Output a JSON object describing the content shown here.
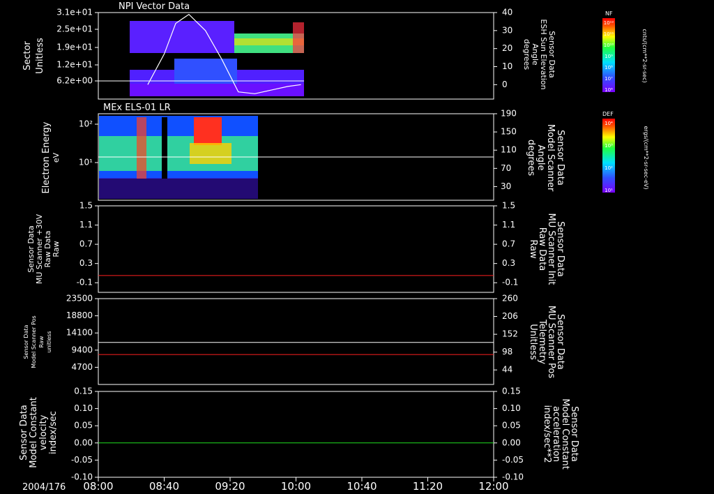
{
  "chart_data": [
    {
      "type": "heatmap",
      "title": "NPI Vector Data",
      "left_axis": {
        "label": [
          "Sector",
          "Unitless"
        ],
        "ticks": [
          "3.1e+01",
          "2.5e+01",
          "1.9e+01",
          "1.2e+01",
          "6.2e+00"
        ]
      },
      "right_axis": {
        "label": [
          "Sensor Data",
          "ESH Sun Elevation",
          "Angle",
          "degrees"
        ],
        "range": [
          -8,
          40
        ],
        "ticks": [
          "40",
          "30",
          "20",
          "10",
          "0"
        ]
      },
      "colorbar": {
        "title": "NF",
        "unit": "cnts/(cm**2-sr-sec)",
        "ticks": [
          "10¹²",
          "10¹¹",
          "10¹⁰",
          "10⁹",
          "10⁸",
          "10⁷",
          "10⁶"
        ]
      },
      "line_series": {
        "color": "#ffffff",
        "x": [
          "08:30",
          "08:40",
          "08:47",
          "08:55",
          "09:05",
          "09:15",
          "09:25",
          "09:35",
          "09:45",
          "09:55",
          "10:03"
        ],
        "y": [
          0,
          17,
          34,
          39,
          30,
          14,
          -4,
          -5,
          -3,
          -1,
          0
        ]
      }
    },
    {
      "type": "heatmap",
      "title": "MEx ELS-01 LR",
      "left_axis": {
        "label": [
          "Electron Energy",
          "eV"
        ],
        "scale": "log",
        "ticks": [
          "10²",
          "10¹"
        ]
      },
      "right_axis": {
        "label": [
          "Sensor Data",
          "Model Scanner",
          "Angle",
          "degrees"
        ],
        "range": [
          0,
          190
        ],
        "ticks": [
          "190",
          "150",
          "110",
          "70",
          "30"
        ]
      },
      "colorbar": {
        "title": "DEF",
        "unit": "ergs/(cm**2-sr-sec-eV)",
        "ticks": [
          "10⁴",
          "10³",
          "10²",
          "10¹"
        ]
      },
      "line_series": {
        "color": "#ffffff",
        "constant": 90
      }
    },
    {
      "type": "line",
      "left_axis": {
        "label": [
          "Sensor Data",
          "MU Scanner +30V",
          "Raw Data",
          "Raw"
        ],
        "range": [
          -0.3,
          1.5
        ],
        "ticks": [
          "1.5",
          "1.1",
          "0.7",
          "0.3",
          "-0.1"
        ]
      },
      "right_axis": {
        "label": [
          "Sensor Data",
          "MU Scanner Init",
          "Raw Data",
          "Raw"
        ],
        "color": "#ff2020",
        "ticks": [
          "1.5",
          "1.1",
          "0.7",
          "0.3",
          "-0.1"
        ]
      },
      "series": [
        {
          "color": "#ff2020",
          "constant": 0.05
        }
      ]
    },
    {
      "type": "line",
      "left_axis": {
        "label": [
          "Sensor Data",
          "Model Scanner Pos",
          "Raw",
          "unitless"
        ],
        "range": [
          0,
          23500
        ],
        "ticks": [
          "23500",
          "18800",
          "14100",
          "9400",
          "4700"
        ]
      },
      "right_axis": {
        "label": [
          "Sensor Data",
          "MU Scanner Pos",
          "Telemetry",
          "Unitless"
        ],
        "color": "#ff2020",
        "range": [
          0,
          260
        ],
        "ticks": [
          "260",
          "206",
          "152",
          "98",
          "44"
        ]
      },
      "series": [
        {
          "color": "#ffffff",
          "constant": 11500
        },
        {
          "color": "#ff2020",
          "constant": 8200
        }
      ]
    },
    {
      "type": "line",
      "left_axis": {
        "label": [
          "Sensor Data",
          "Model Constant",
          "velocity",
          "index/sec"
        ],
        "range": [
          -0.1,
          0.15
        ],
        "ticks": [
          "0.15",
          "0.10",
          "0.05",
          "0.00",
          "-0.05",
          "-0.10"
        ]
      },
      "right_axis": {
        "label": [
          "Sensor Data",
          "Model Constant",
          "acceleration",
          "index/sec**2"
        ],
        "color": "#20e020",
        "ticks": [
          "0.15",
          "0.10",
          "0.05",
          "0.00",
          "-0.05",
          "-0.10"
        ]
      },
      "series": [
        {
          "color": "#20e020",
          "constant": 0.0
        }
      ]
    }
  ],
  "x_axis": {
    "date": "2004/176",
    "ticks": [
      "08:00",
      "08:40",
      "09:20",
      "10:00",
      "10:40",
      "11:20",
      "12:00"
    ],
    "range": [
      "08:00",
      "12:00"
    ]
  }
}
